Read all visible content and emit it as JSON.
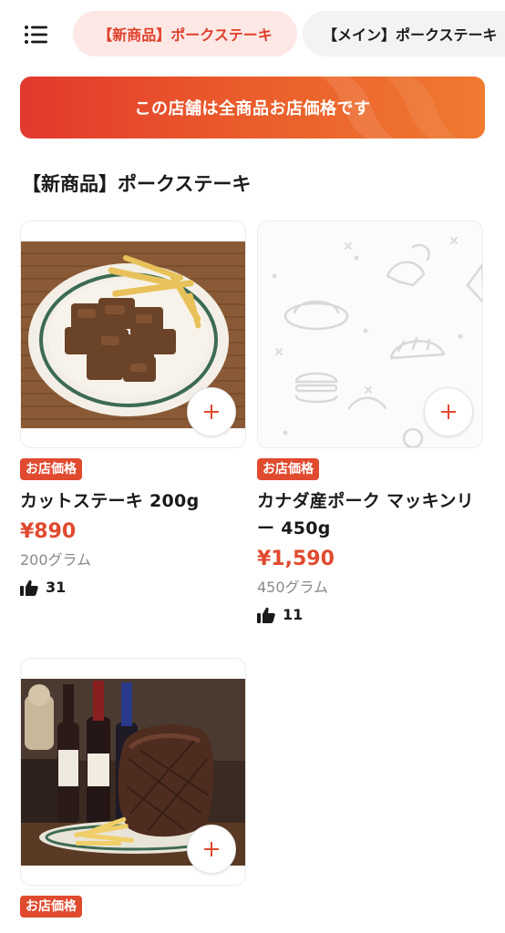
{
  "tabs": [
    {
      "label": "【新商品】ポークステーキ",
      "active": true
    },
    {
      "label": "【メイン】ポークステーキ",
      "active": false
    }
  ],
  "banner": {
    "text": "この店舗は全商品お店価格です"
  },
  "section": {
    "title": "【新商品】ポークステーキ"
  },
  "products": [
    {
      "badge": "お店価格",
      "name": "カットステーキ 200g",
      "price": "¥890",
      "weight": "200グラム",
      "likes": "31",
      "image": "steak-plate-photo"
    },
    {
      "badge": "お店価格",
      "name": "カナダ産ポーク マッキンリー 450g",
      "price": "¥1,590",
      "weight": "450グラム",
      "likes": "11",
      "image": "placeholder-food-pattern"
    },
    {
      "badge": "お店価格",
      "name": "",
      "price": "",
      "weight": "",
      "likes": "",
      "image": "roast-wine-photo"
    }
  ],
  "icons": {
    "menu": "hamburger-list-icon",
    "add": "plus-icon",
    "like": "thumbs-up-icon"
  },
  "colors": {
    "accent": "#e04a2f",
    "tab_active_bg": "#fde8e6",
    "banner_start": "#e2392d",
    "banner_end": "#ef7a30"
  }
}
